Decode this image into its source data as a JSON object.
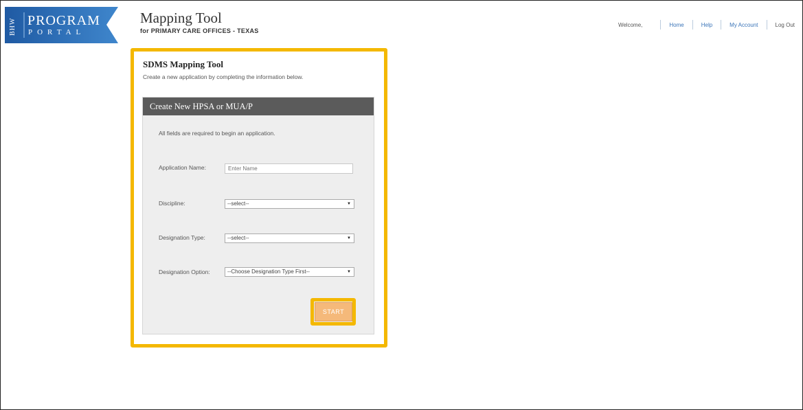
{
  "logo": {
    "side_text": "BHW",
    "main_text": "PROGRAM",
    "sub_text": "PORTAL",
    "color": "#2f6fb8"
  },
  "header": {
    "title": "Mapping Tool",
    "subtitle": "for PRIMARY CARE OFFICES - TEXAS"
  },
  "topnav": {
    "welcome": "Welcome,",
    "links": [
      "Home",
      "Help",
      "My Account",
      "Log Out"
    ]
  },
  "card": {
    "title": "SDMS Mapping Tool",
    "description": "Create a new application by completing the information below.",
    "panel_title": "Create New HPSA or MUA/P",
    "required_note": "All fields are required to begin an application."
  },
  "form": {
    "application_name": {
      "label": "Application Name:",
      "placeholder": "Enter Name",
      "value": ""
    },
    "discipline": {
      "label": "Discipline:",
      "selected": "--select--"
    },
    "designation_type": {
      "label": "Designation Type:",
      "selected": "--select--"
    },
    "designation_option": {
      "label": "Designation Option:",
      "selected": "--Choose Designation Type First--"
    },
    "start_label": "START"
  },
  "colors": {
    "highlight": "#f4b800",
    "panel_header": "#5b5b5b",
    "start_button": "#f5b97a",
    "link": "#3a74b8"
  }
}
